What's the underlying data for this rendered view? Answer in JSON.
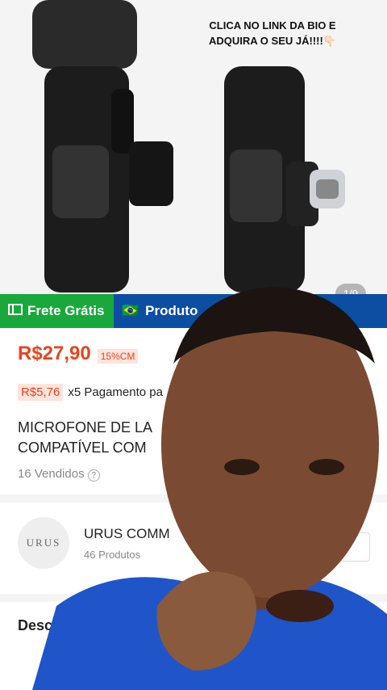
{
  "overlay": {
    "caption": "CLICA NO LINK DA BIO E ADQUIRA O SEU JÁ!!!!👇🏻"
  },
  "gallery": {
    "counter": "1/9"
  },
  "badges": {
    "frete": "Frete Grátis",
    "produto": "Produto",
    "flag_glyph": "🇧🇷"
  },
  "price": {
    "value": "R$27,90",
    "discount": "15%CM"
  },
  "installment": {
    "price": "R$5,76",
    "text": "x5 Pagamento pa"
  },
  "product": {
    "title_line1": "MICROFONE DE LA",
    "title_line2": "COMPATÍVEL COM",
    "sold": "16 Vendidos",
    "info_glyph": "?"
  },
  "store": {
    "logo_text": "URUS",
    "name": "URUS COMM",
    "count": "46 Produtos"
  },
  "description": {
    "title": "Descri"
  },
  "icons": {
    "frete": "truck-icon",
    "produto": "flag-icon",
    "info": "info-icon"
  },
  "colors": {
    "price": "#e8431f",
    "frete_badge": "#19a83c",
    "produto_badge": "#0b4ea2",
    "shirt": "#1f55c8",
    "skin": "#7a4b32"
  }
}
